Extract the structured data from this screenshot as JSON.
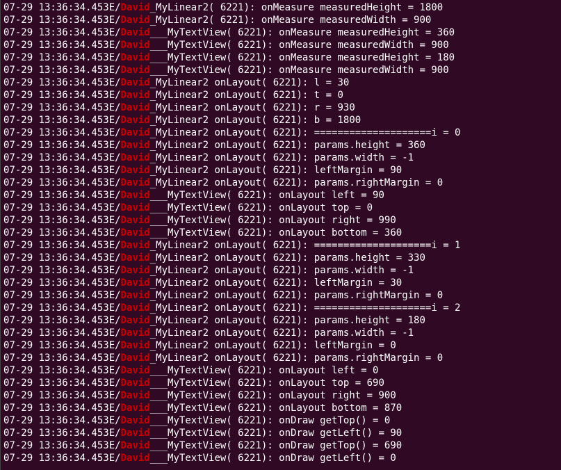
{
  "logs": [
    {
      "ts": "07-29 13:36:34.453",
      "lvl": "E",
      "tag": "David",
      "suffix": "_MyLinear2( 6221)",
      "msg": ": onMeasure measuredHeight = 1800"
    },
    {
      "ts": "07-29 13:36:34.453",
      "lvl": "E",
      "tag": "David",
      "suffix": "_MyLinear2( 6221)",
      "msg": ": onMeasure measuredWidth = 900"
    },
    {
      "ts": "07-29 13:36:34.453",
      "lvl": "E",
      "tag": "David",
      "suffix": "___MyTextView( 6221)",
      "msg": ": onMeasure measuredHeight = 360"
    },
    {
      "ts": "07-29 13:36:34.453",
      "lvl": "E",
      "tag": "David",
      "suffix": "___MyTextView( 6221)",
      "msg": ": onMeasure measuredWidth = 900"
    },
    {
      "ts": "07-29 13:36:34.453",
      "lvl": "E",
      "tag": "David",
      "suffix": "___MyTextView( 6221)",
      "msg": ": onMeasure measuredHeight = 180"
    },
    {
      "ts": "07-29 13:36:34.453",
      "lvl": "E",
      "tag": "David",
      "suffix": "___MyTextView( 6221)",
      "msg": ": onMeasure measuredWidth = 900"
    },
    {
      "ts": "07-29 13:36:34.453",
      "lvl": "E",
      "tag": "David",
      "suffix": "_MyLinear2 onLayout( 6221)",
      "msg": ": l = 30"
    },
    {
      "ts": "07-29 13:36:34.453",
      "lvl": "E",
      "tag": "David",
      "suffix": "_MyLinear2 onLayout( 6221)",
      "msg": ": t = 0"
    },
    {
      "ts": "07-29 13:36:34.453",
      "lvl": "E",
      "tag": "David",
      "suffix": "_MyLinear2 onLayout( 6221)",
      "msg": ": r = 930"
    },
    {
      "ts": "07-29 13:36:34.453",
      "lvl": "E",
      "tag": "David",
      "suffix": "_MyLinear2 onLayout( 6221)",
      "msg": ": b = 1800"
    },
    {
      "ts": "07-29 13:36:34.453",
      "lvl": "E",
      "tag": "David",
      "suffix": "_MyLinear2 onLayout( 6221)",
      "msg": ": ====================i = 0"
    },
    {
      "ts": "07-29 13:36:34.453",
      "lvl": "E",
      "tag": "David",
      "suffix": "_MyLinear2 onLayout( 6221)",
      "msg": ": params.height = 360"
    },
    {
      "ts": "07-29 13:36:34.453",
      "lvl": "E",
      "tag": "David",
      "suffix": "_MyLinear2 onLayout( 6221)",
      "msg": ": params.width = -1"
    },
    {
      "ts": "07-29 13:36:34.453",
      "lvl": "E",
      "tag": "David",
      "suffix": "_MyLinear2 onLayout( 6221)",
      "msg": ": leftMargin = 90"
    },
    {
      "ts": "07-29 13:36:34.453",
      "lvl": "E",
      "tag": "David",
      "suffix": "_MyLinear2 onLayout( 6221)",
      "msg": ": params.rightMargin = 0"
    },
    {
      "ts": "07-29 13:36:34.453",
      "lvl": "E",
      "tag": "David",
      "suffix": "___MyTextView( 6221)",
      "msg": ": onLayout left = 90"
    },
    {
      "ts": "07-29 13:36:34.453",
      "lvl": "E",
      "tag": "David",
      "suffix": "___MyTextView( 6221)",
      "msg": ": onLayout top = 0"
    },
    {
      "ts": "07-29 13:36:34.453",
      "lvl": "E",
      "tag": "David",
      "suffix": "___MyTextView( 6221)",
      "msg": ": onLayout right = 990"
    },
    {
      "ts": "07-29 13:36:34.453",
      "lvl": "E",
      "tag": "David",
      "suffix": "___MyTextView( 6221)",
      "msg": ": onLayout bottom = 360"
    },
    {
      "ts": "07-29 13:36:34.453",
      "lvl": "E",
      "tag": "David",
      "suffix": "_MyLinear2 onLayout( 6221)",
      "msg": ": ====================i = 1"
    },
    {
      "ts": "07-29 13:36:34.453",
      "lvl": "E",
      "tag": "David",
      "suffix": "_MyLinear2 onLayout( 6221)",
      "msg": ": params.height = 330"
    },
    {
      "ts": "07-29 13:36:34.453",
      "lvl": "E",
      "tag": "David",
      "suffix": "_MyLinear2 onLayout( 6221)",
      "msg": ": params.width = -1"
    },
    {
      "ts": "07-29 13:36:34.453",
      "lvl": "E",
      "tag": "David",
      "suffix": "_MyLinear2 onLayout( 6221)",
      "msg": ": leftMargin = 30"
    },
    {
      "ts": "07-29 13:36:34.453",
      "lvl": "E",
      "tag": "David",
      "suffix": "_MyLinear2 onLayout( 6221)",
      "msg": ": params.rightMargin = 0"
    },
    {
      "ts": "07-29 13:36:34.453",
      "lvl": "E",
      "tag": "David",
      "suffix": "_MyLinear2 onLayout( 6221)",
      "msg": ": ====================i = 2"
    },
    {
      "ts": "07-29 13:36:34.453",
      "lvl": "E",
      "tag": "David",
      "suffix": "_MyLinear2 onLayout( 6221)",
      "msg": ": params.height = 180"
    },
    {
      "ts": "07-29 13:36:34.453",
      "lvl": "E",
      "tag": "David",
      "suffix": "_MyLinear2 onLayout( 6221)",
      "msg": ": params.width = -1"
    },
    {
      "ts": "07-29 13:36:34.453",
      "lvl": "E",
      "tag": "David",
      "suffix": "_MyLinear2 onLayout( 6221)",
      "msg": ": leftMargin = 0"
    },
    {
      "ts": "07-29 13:36:34.453",
      "lvl": "E",
      "tag": "David",
      "suffix": "_MyLinear2 onLayout( 6221)",
      "msg": ": params.rightMargin = 0"
    },
    {
      "ts": "07-29 13:36:34.453",
      "lvl": "E",
      "tag": "David",
      "suffix": "___MyTextView( 6221)",
      "msg": ": onLayout left = 0"
    },
    {
      "ts": "07-29 13:36:34.453",
      "lvl": "E",
      "tag": "David",
      "suffix": "___MyTextView( 6221)",
      "msg": ": onLayout top = 690"
    },
    {
      "ts": "07-29 13:36:34.453",
      "lvl": "E",
      "tag": "David",
      "suffix": "___MyTextView( 6221)",
      "msg": ": onLayout right = 900"
    },
    {
      "ts": "07-29 13:36:34.453",
      "lvl": "E",
      "tag": "David",
      "suffix": "___MyTextView( 6221)",
      "msg": ": onLayout bottom = 870"
    },
    {
      "ts": "07-29 13:36:34.453",
      "lvl": "E",
      "tag": "David",
      "suffix": "___MyTextView( 6221)",
      "msg": ": onDraw getTop() = 0"
    },
    {
      "ts": "07-29 13:36:34.453",
      "lvl": "E",
      "tag": "David",
      "suffix": "___MyTextView( 6221)",
      "msg": ": onDraw getLeft() = 90"
    },
    {
      "ts": "07-29 13:36:34.453",
      "lvl": "E",
      "tag": "David",
      "suffix": "___MyTextView( 6221)",
      "msg": ": onDraw getTop() = 690"
    },
    {
      "ts": "07-29 13:36:34.453",
      "lvl": "E",
      "tag": "David",
      "suffix": "___MyTextView( 6221)",
      "msg": ": onDraw getLeft() = 0"
    }
  ]
}
